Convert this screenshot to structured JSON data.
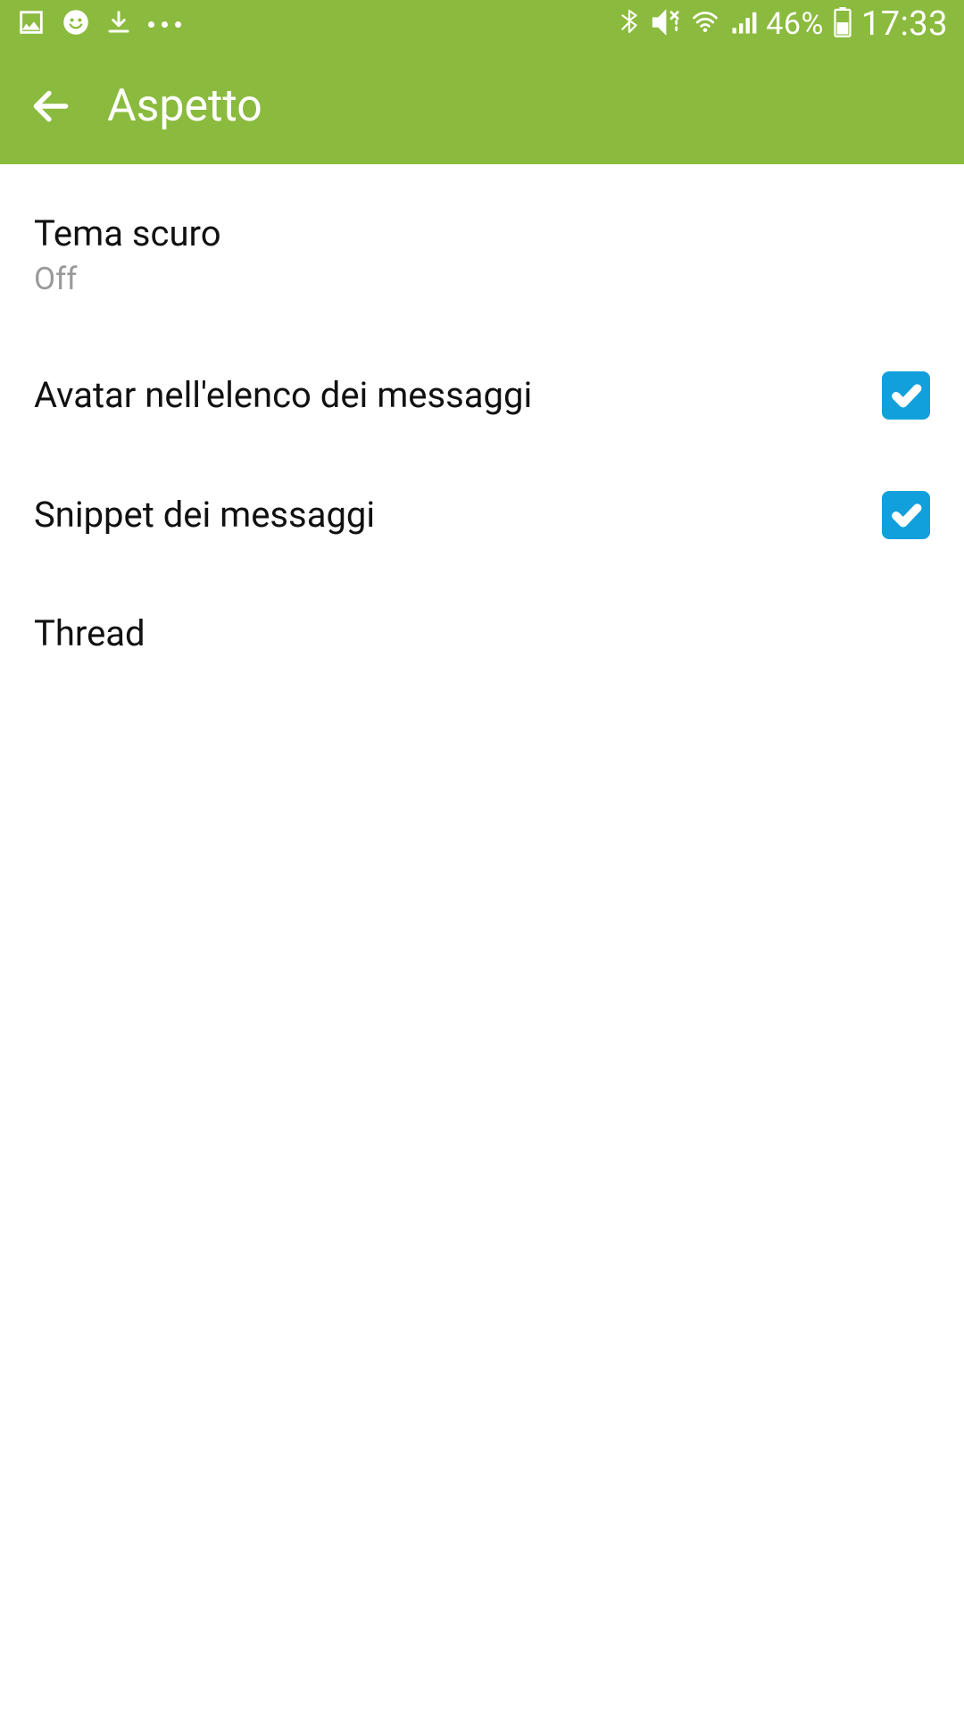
{
  "statusbar": {
    "battery_pct": "46%",
    "time": "17:33"
  },
  "header": {
    "title": "Aspetto"
  },
  "settings": {
    "dark_theme": {
      "title": "Tema scuro",
      "value": "Off"
    },
    "avatar": {
      "title": "Avatar nell'elenco dei messaggi",
      "checked": true
    },
    "snippet": {
      "title": "Snippet dei messaggi",
      "checked": true
    },
    "thread": {
      "title": "Thread"
    }
  }
}
